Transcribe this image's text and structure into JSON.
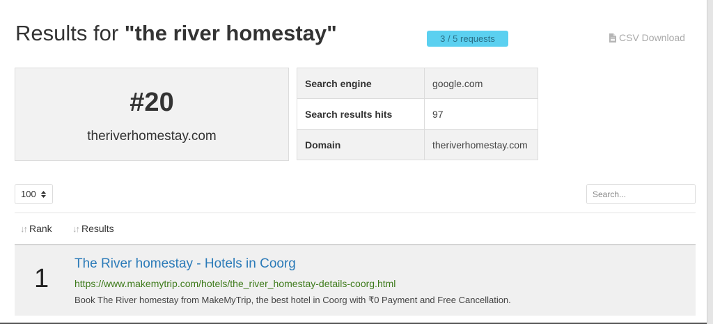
{
  "header": {
    "title_prefix": "Results for ",
    "query": "\"the river homestay\"",
    "requests_badge": "3 / 5 requests",
    "csv_label": "CSV Download",
    "csv_icon": "file-icon"
  },
  "summary": {
    "rank": "#20",
    "domain": "theriverhomestay.com"
  },
  "info_table": [
    {
      "label": "Search engine",
      "value": "google.com"
    },
    {
      "label": "Search results hits",
      "value": "97"
    },
    {
      "label": "Domain",
      "value": "theriverhomestay.com"
    }
  ],
  "controls": {
    "page_size": "100",
    "search_placeholder": "Search..."
  },
  "table": {
    "columns": [
      "Rank",
      "Results"
    ],
    "rows": [
      {
        "rank": "1",
        "title": "The River homestay - Hotels in Coorg",
        "url": "https://www.makemytrip.com/hotels/the_river_homestay-details-coorg.html",
        "description": "Book The River homestay from MakeMyTrip, the best hotel in Coorg with ₹0 Payment and Free Cancellation."
      }
    ]
  },
  "colors": {
    "badge_bg": "#5bd0f0",
    "link": "#2a7ab8",
    "url": "#3d7a1a"
  }
}
